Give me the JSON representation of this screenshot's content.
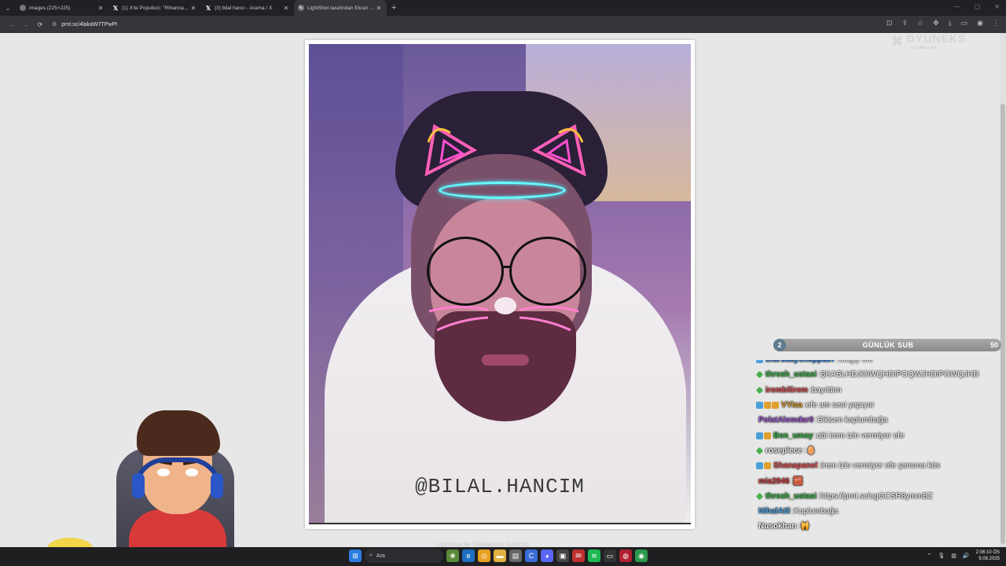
{
  "browser": {
    "tabs": [
      {
        "title": "images (225×225)",
        "active": false,
        "icon": "globe-icon"
      },
      {
        "title": "(1) X'te Populicci: \"Rihanna, Lo",
        "active": false,
        "icon": "x-logo-icon"
      },
      {
        "title": "(3) bilal hancı - Arama / X",
        "active": false,
        "icon": "x-logo-icon"
      },
      {
        "title": "LightShot tarafından Ekran Gö",
        "active": true,
        "icon": "feather-icon"
      }
    ],
    "new_tab": "+",
    "url": "prnt.sc/4lakaW7TPwPt"
  },
  "photo": {
    "watermark": "@BILAL.HANCIM",
    "caption": "Lightshot ile Yakalanmış Görüntü"
  },
  "overlay": {
    "logo_word": "OYUNEKS",
    "logo_sub": "oyuneks.com"
  },
  "sub_goal": {
    "current": "2",
    "label": "GÜNLÜK SUB",
    "goal": "50"
  },
  "chat": [
    {
      "user": "thursdaychoppa37",
      "color": "#2f7fd8",
      "badges": [
        "blue"
      ],
      "msg": "dolgiy efe",
      "partial": true
    },
    {
      "user": "thresh_ustasi",
      "color": "#3db54a",
      "badges": [
        "green"
      ],
      "msg": "ŞKASLHDJOIWQHDIPOQWJHDIPOWQJHD"
    },
    {
      "user": "irembilirem",
      "color": "#e05050",
      "badges": [
        "green"
      ],
      "msg": "bayıldım"
    },
    {
      "user": "VYisa",
      "color": "#e0a030",
      "badges": [
        "blue",
        "gold",
        "gold"
      ],
      "msg": "efe am sesi yapıyor"
    },
    {
      "user": "PolatAlemdar0",
      "color": "#9b59d0",
      "badges": [],
      "msg": "Sikisen kaplumbağa"
    },
    {
      "user": "Ben_umay",
      "color": "#3db54a",
      "badges": [
        "blue",
        "gold"
      ],
      "msg": "abi irem izin vermiyor efe"
    },
    {
      "user": "rosepiece",
      "color": "#f0f0f0",
      "badges": [
        "green"
      ],
      "msg": "🥚"
    },
    {
      "user": "Shanapanel",
      "color": "#e05050",
      "badges": [
        "blue",
        "gold"
      ],
      "msg": "irem izin vermiyor efe şansına küs"
    },
    {
      "user": "mia2046",
      "color": "#d04040",
      "badges": [],
      "msg": "🧱"
    },
    {
      "user": "thresh_ustasi",
      "color": "#3db54a",
      "badges": [
        "green"
      ],
      "msg": "https://prnt.sc/ugGCSR8ymmBZ"
    },
    {
      "user": "NihalAtli",
      "color": "#4aa0e0",
      "badges": [],
      "msg": "Kaplumbağa"
    },
    {
      "user": "Nusokhan",
      "color": "#f0f0f0",
      "badges": [],
      "msg": "🙀"
    }
  ],
  "taskbar": {
    "search_placeholder": "Ara",
    "time": "2:06:10 ÖS",
    "date": "9.08.2025"
  },
  "colors": {
    "accent_halo": "#66ffff",
    "sub_badge": "#5f7b8c"
  }
}
